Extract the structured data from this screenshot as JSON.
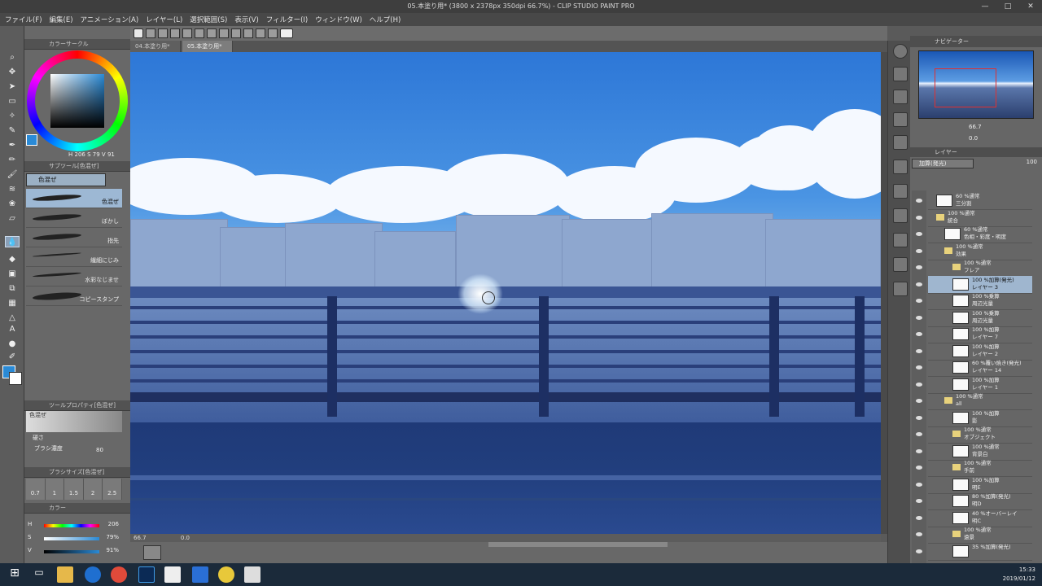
{
  "window": {
    "title": "05.本塗り用* (3800 x 2378px 350dpi 66.7%) - CLIP STUDIO PAINT PRO",
    "controls": [
      "—",
      "□",
      "✕"
    ]
  },
  "menu": [
    "ファイル(F)",
    "編集(E)",
    "アニメーション(A)",
    "レイヤー(L)",
    "選択範囲(S)",
    "表示(V)",
    "フィルター(I)",
    "ウィンドウ(W)",
    "ヘルプ(H)"
  ],
  "doc_tabs": [
    "04.本塗り用*",
    "05.本塗り用*"
  ],
  "color_circle": {
    "title": "カラーサークル",
    "h": "206",
    "s": "79",
    "v": "91",
    "color": "#2a8ad6"
  },
  "sub_tool": {
    "title": "サブツール[色混ぜ]",
    "tab": "色混ぜ",
    "brushes": [
      "色混ぜ",
      "ぼかし",
      "指先",
      "繊細にじみ",
      "水彩なじませ",
      "コピースタンプ"
    ]
  },
  "tool_property": {
    "title": "ツールプロパティ[色混ぜ]",
    "name": "色混ぜ",
    "hardness": "硬さ",
    "density_label": "ブラシ濃度",
    "density": "80"
  },
  "brush_size": {
    "title": "ブラシサイズ[色混ぜ]",
    "sizes": [
      "0.7",
      "1",
      "1.5",
      "2",
      "2.5"
    ]
  },
  "color_slider": {
    "title": "カラー",
    "rows": [
      {
        "k": "H",
        "v": "206"
      },
      {
        "k": "S",
        "v": "79%"
      },
      {
        "k": "V",
        "v": "91%"
      }
    ]
  },
  "status": {
    "zoom": "66.7",
    "rotate": "0.0"
  },
  "navigator": {
    "title": "ナビゲーター",
    "zoom": "66.7",
    "rotate": "0.0"
  },
  "layer_panel": {
    "title": "レイヤー",
    "blend": "加算(発光)",
    "opacity": "100",
    "layers": [
      {
        "l1": "60 %通常",
        "l2": "三分割",
        "type": "layer",
        "indent": 0
      },
      {
        "l1": "100 %通常",
        "l2": "統合",
        "type": "folder",
        "indent": 0
      },
      {
        "l1": "60 %通常",
        "l2": "色相・彩度・明度",
        "type": "layer",
        "indent": 1
      },
      {
        "l1": "100 %通常",
        "l2": "効果",
        "type": "folder",
        "indent": 1
      },
      {
        "l1": "100 %通常",
        "l2": "フレア",
        "type": "folder",
        "indent": 2
      },
      {
        "l1": "100 %加算(発光)",
        "l2": "レイヤー 3",
        "type": "layer",
        "indent": 2,
        "selected": true
      },
      {
        "l1": "100 %乗算",
        "l2": "周辺光量",
        "type": "layer",
        "indent": 2
      },
      {
        "l1": "100 %乗算",
        "l2": "周辺光量",
        "type": "layer",
        "indent": 2
      },
      {
        "l1": "100 %加算",
        "l2": "レイヤー 7",
        "type": "layer",
        "indent": 2
      },
      {
        "l1": "100 %加算",
        "l2": "レイヤー 2",
        "type": "layer",
        "indent": 2
      },
      {
        "l1": "60 %覆い焼き(発光)",
        "l2": "レイヤー 14",
        "type": "layer",
        "indent": 2
      },
      {
        "l1": "100 %加算",
        "l2": "レイヤー 1",
        "type": "layer",
        "indent": 2
      },
      {
        "l1": "100 %通常",
        "l2": "all",
        "type": "folder",
        "indent": 1
      },
      {
        "l1": "100 %加算",
        "l2": "影",
        "type": "layer",
        "indent": 2
      },
      {
        "l1": "100 %通常",
        "l2": "オブジェクト",
        "type": "folder",
        "indent": 2
      },
      {
        "l1": "100 %通常",
        "l2": "背景白",
        "type": "layer",
        "indent": 2
      },
      {
        "l1": "100 %通常",
        "l2": "手前",
        "type": "folder",
        "indent": 2
      },
      {
        "l1": "100 %加算",
        "l2": "明E",
        "type": "layer",
        "indent": 2
      },
      {
        "l1": "80 %加算(発光)",
        "l2": "明D",
        "type": "layer",
        "indent": 2
      },
      {
        "l1": "40 %オーバーレイ",
        "l2": "明C",
        "type": "layer",
        "indent": 2
      },
      {
        "l1": "100 %通常",
        "l2": "遠景",
        "type": "folder",
        "indent": 2
      },
      {
        "l1": "35 %加算(発光)",
        "l2": "",
        "type": "layer",
        "indent": 2
      }
    ]
  },
  "taskbar": {
    "time": "15:33",
    "date": "2019/01/12"
  }
}
